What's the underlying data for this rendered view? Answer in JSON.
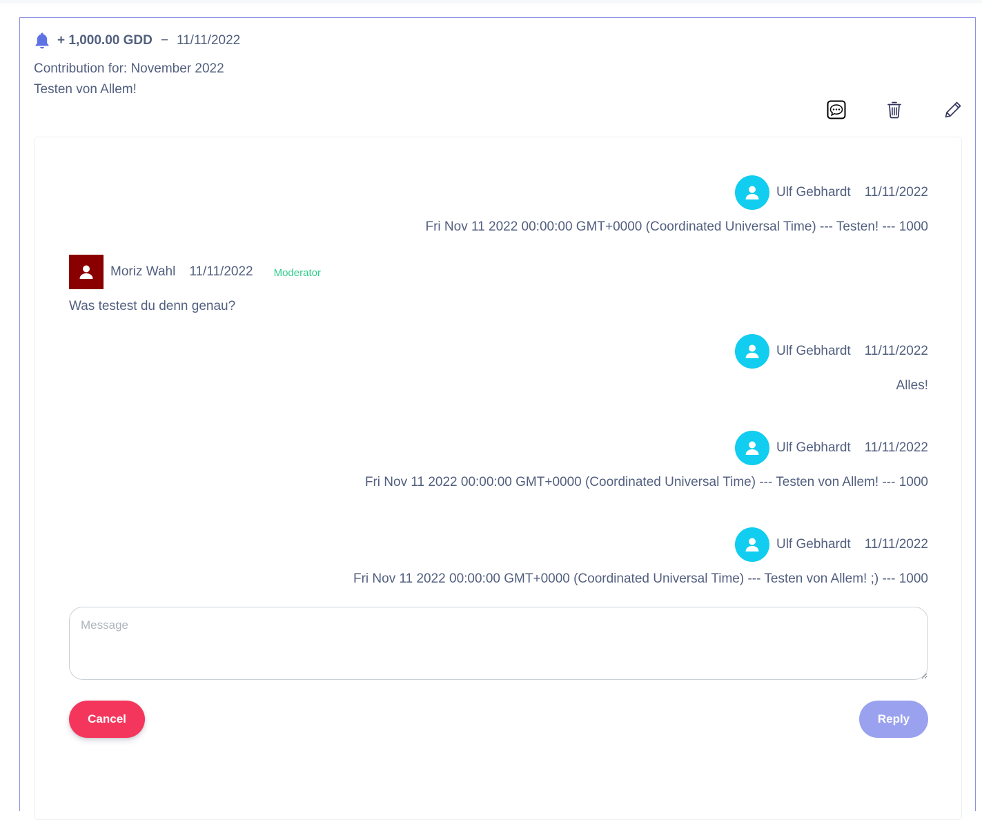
{
  "transaction": {
    "amount": "+ 1,000.00 GDD",
    "separator": "−",
    "date": "11/11/2022",
    "memo_line1": "Contribution for: November 2022",
    "memo_line2": "Testen von Allem!"
  },
  "icons": {
    "bell": "bell-icon",
    "chat": "chat-dots-icon",
    "trash": "trash-icon",
    "edit": "pencil-icon",
    "user": "person-icon"
  },
  "colors": {
    "accent": "#5e72e4",
    "user_avatar": "#11cdef",
    "moderator_avatar": "#8a0000",
    "moderator_label": "#2dce89",
    "cancel": "#f5365c",
    "reply_disabled": "#9aa2ef"
  },
  "messages": [
    {
      "author": "Ulf Gebhardt",
      "date": "11/11/2022",
      "text": "Fri Nov 11 2022 00:00:00 GMT+0000 (Coordinated Universal Time) --- Testen! --- 1000"
    },
    {
      "author": "Moriz Wahl",
      "date": "11/11/2022",
      "role": "Moderator",
      "text": "Was testest du denn genau?"
    },
    {
      "author": "Ulf Gebhardt",
      "date": "11/11/2022",
      "text": "Alles!"
    },
    {
      "author": "Ulf Gebhardt",
      "date": "11/11/2022",
      "text": "Fri Nov 11 2022 00:00:00 GMT+0000 (Coordinated Universal Time) --- Testen von Allem! --- 1000"
    },
    {
      "author": "Ulf Gebhardt",
      "date": "11/11/2022",
      "text": "Fri Nov 11 2022 00:00:00 GMT+0000 (Coordinated Universal Time) --- Testen von Allem! ;) --- 1000"
    }
  ],
  "reply_form": {
    "placeholder": "Message",
    "value": "",
    "cancel_label": "Cancel",
    "reply_label": "Reply"
  }
}
